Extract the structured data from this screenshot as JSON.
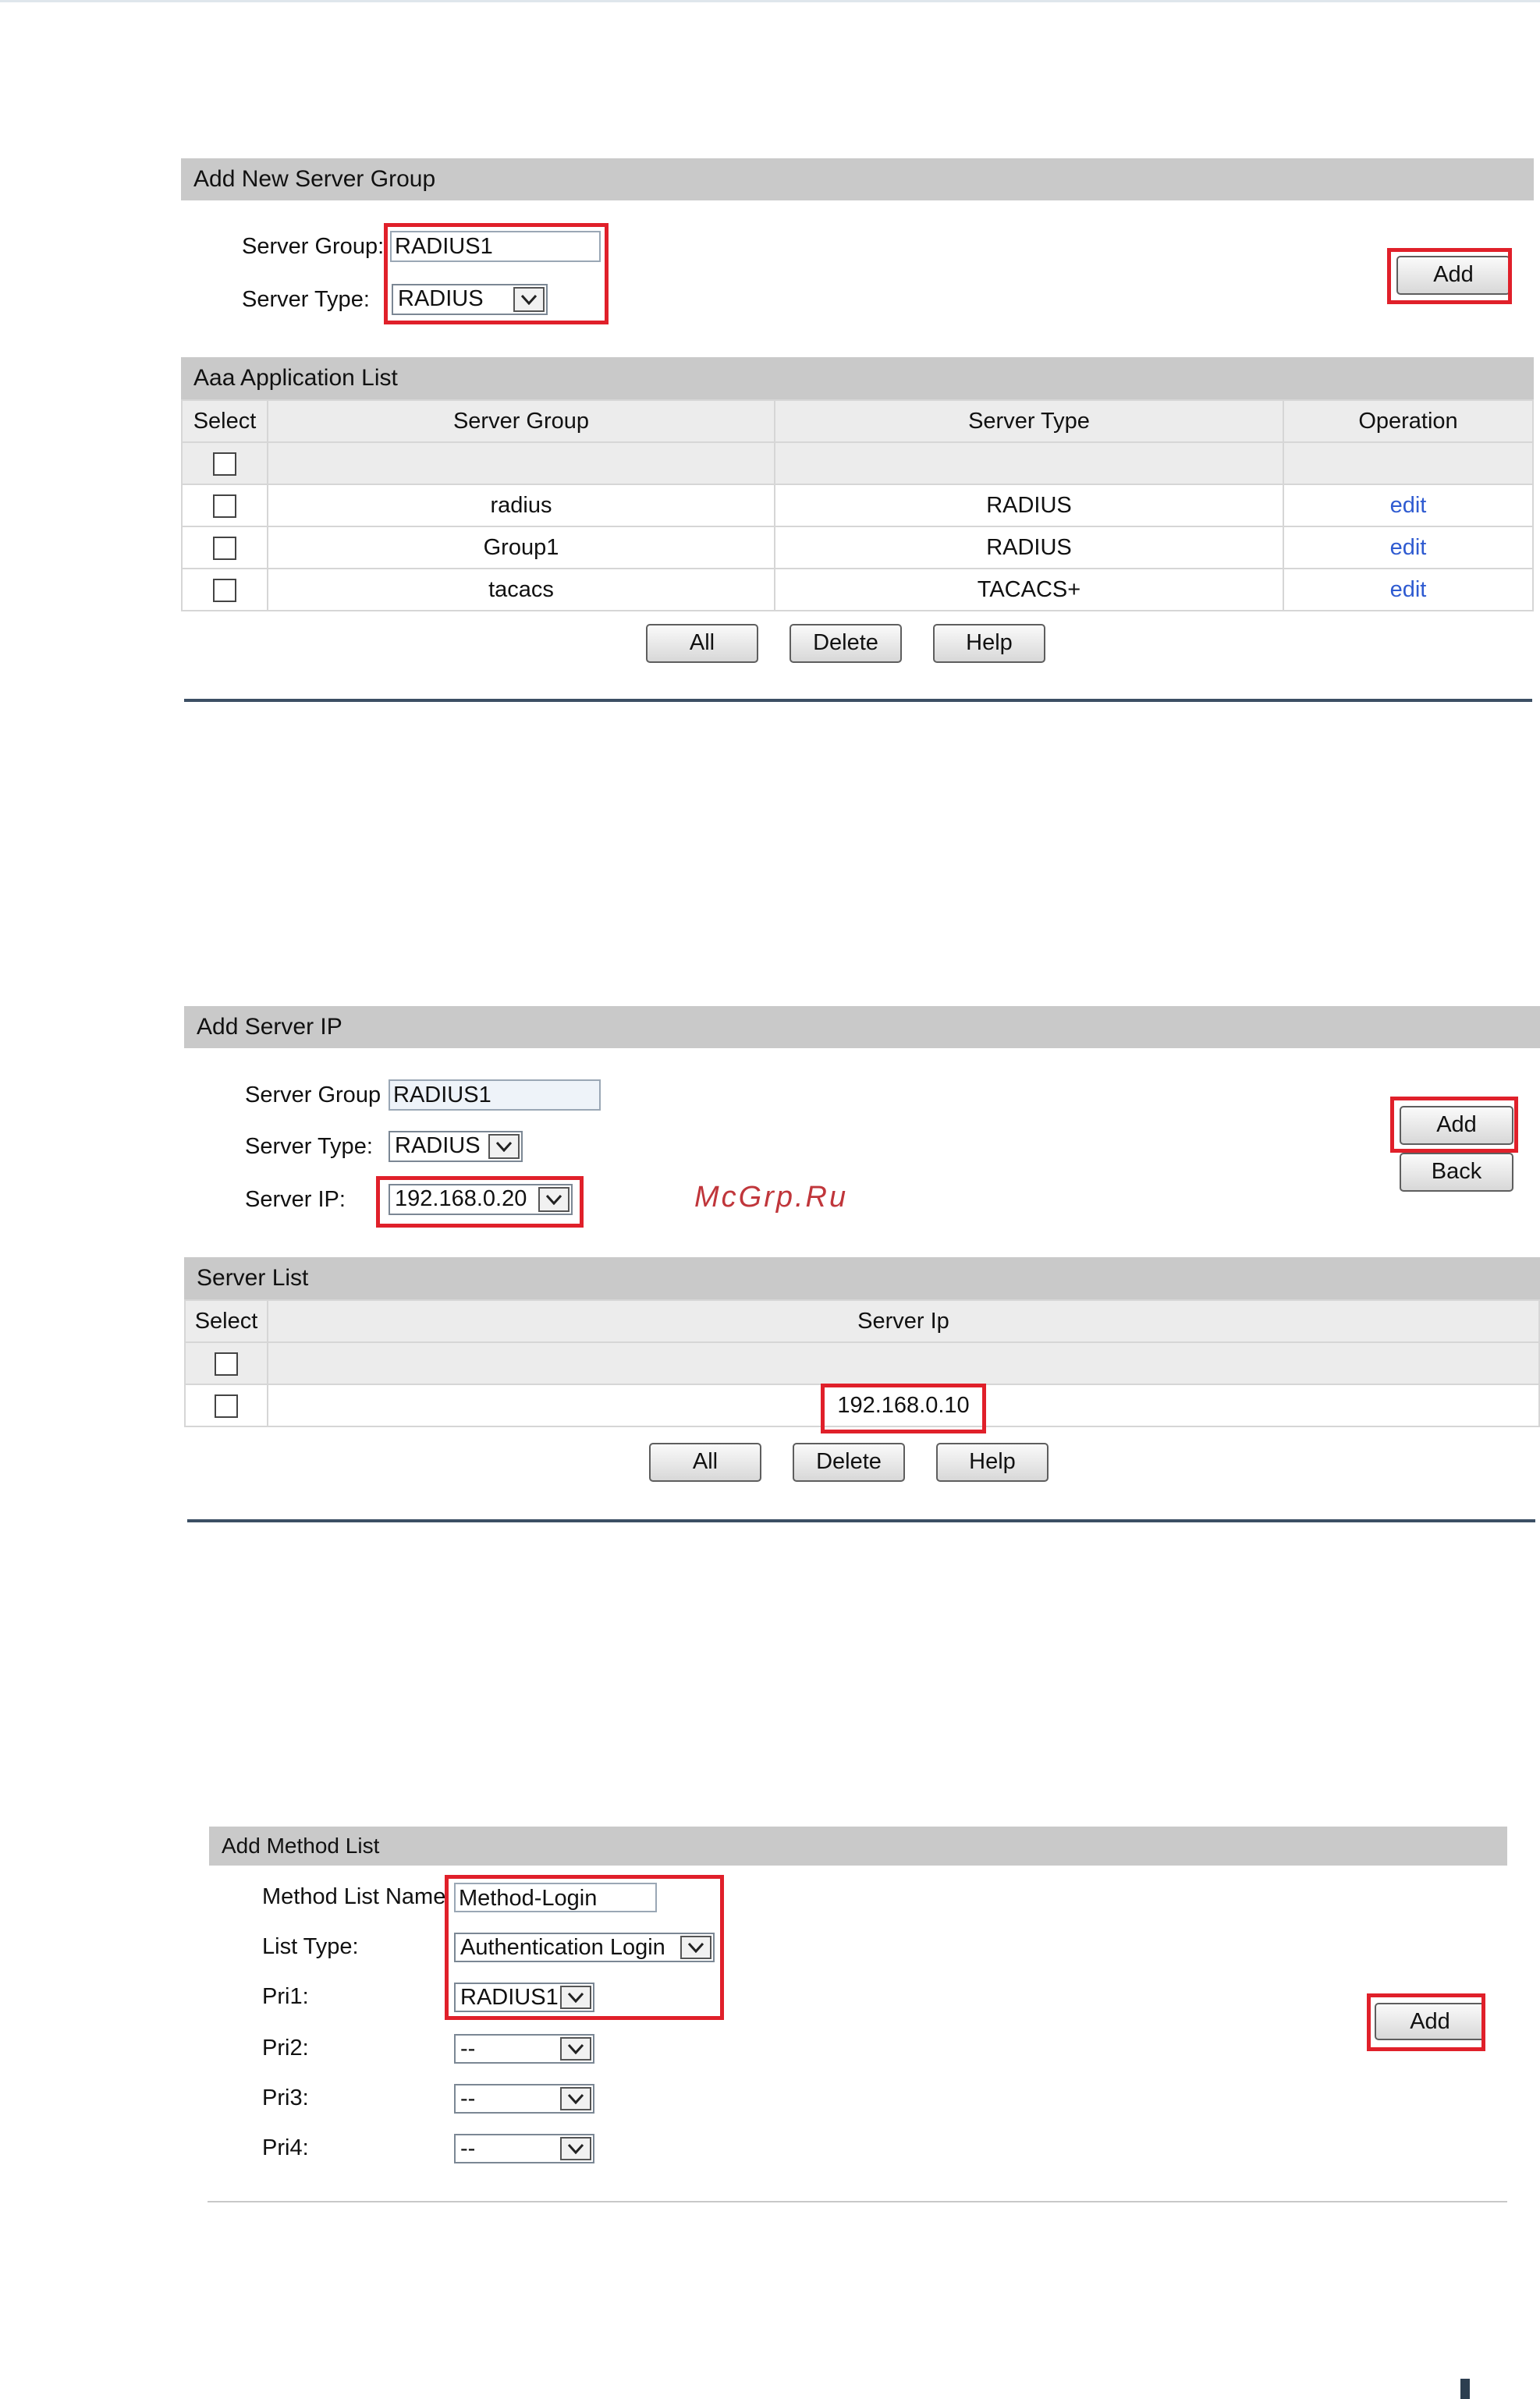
{
  "panel1": {
    "header": "Add New Server Group",
    "server_group_label": "Server Group:",
    "server_group_value": "RADIUS1",
    "server_type_label": "Server Type:",
    "server_type_value": "RADIUS",
    "add_label": "Add"
  },
  "panel2": {
    "header": "Aaa Application List",
    "columns": [
      "Select",
      "Server Group",
      "Server Type",
      "Operation"
    ],
    "rows": [
      {
        "server_group": "radius",
        "server_type": "RADIUS",
        "operation": "edit"
      },
      {
        "server_group": "Group1",
        "server_type": "RADIUS",
        "operation": "edit"
      },
      {
        "server_group": "tacacs",
        "server_type": "TACACS+",
        "operation": "edit"
      }
    ],
    "buttons": {
      "all": "All",
      "delete": "Delete",
      "help": "Help"
    }
  },
  "panel3": {
    "header": "Add Server IP",
    "server_group_label": "Server Group",
    "server_group_value": "RADIUS1",
    "server_type_label": "Server Type:",
    "server_type_value": "RADIUS",
    "server_ip_label": "Server IP:",
    "server_ip_value": "192.168.0.20",
    "add_label": "Add",
    "back_label": "Back"
  },
  "watermark": "McGrp.Ru",
  "panel4": {
    "header": "Server List",
    "columns": [
      "Select",
      "Server Ip"
    ],
    "rows": [
      {
        "server_ip": "192.168.0.10"
      }
    ],
    "buttons": {
      "all": "All",
      "delete": "Delete",
      "help": "Help"
    }
  },
  "panel5": {
    "header": "Add Method List",
    "method_list_name_label": "Method List Name",
    "method_list_name_value": "Method-Login",
    "list_type_label": "List Type:",
    "list_type_value": "Authentication Login",
    "pri1_label": "Pri1:",
    "pri1_value": "RADIUS1",
    "pri2_label": "Pri2:",
    "pri2_value": "--",
    "pri3_label": "Pri3:",
    "pri3_value": "--",
    "pri4_label": "Pri4:",
    "pri4_value": "--",
    "add_label": "Add"
  },
  "colors": {
    "highlight": "#e0202a",
    "header_bar": "#c9c9c9",
    "link": "#2f5bd1",
    "separator": "#3c4f64"
  }
}
